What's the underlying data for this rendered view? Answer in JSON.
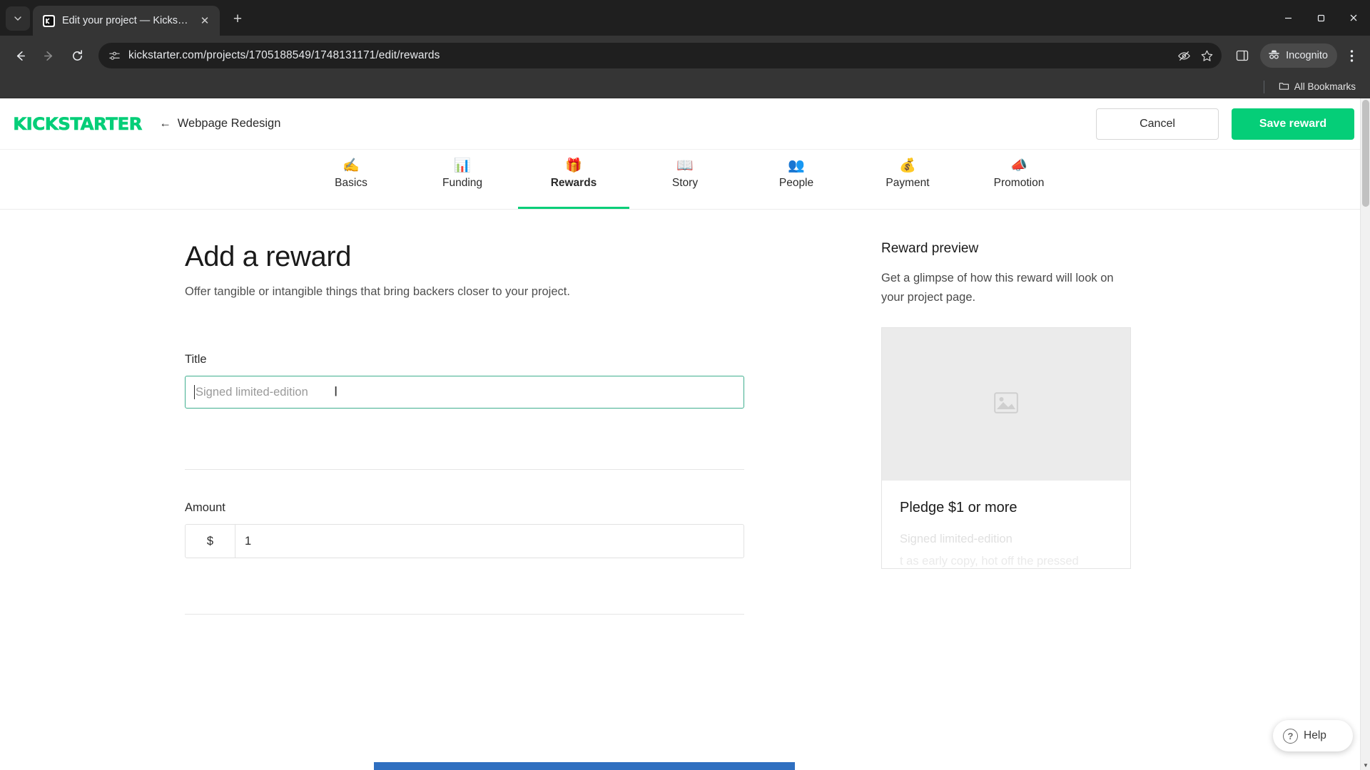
{
  "browser": {
    "tab": {
      "title": "Edit your project — Kickstarter",
      "favicon_name": "kickstarter-favicon",
      "close_label": "✕"
    },
    "new_tab_label": "+",
    "tab_list_label": "⌄",
    "url": "kickstarter.com/projects/1705188549/1748131171/edit/rewards",
    "profile_label": "Incognito",
    "bookmarks": {
      "all_bookmarks_label": "All Bookmarks"
    },
    "window": {
      "minimize": "—",
      "maximize": "▢",
      "close": "✕"
    },
    "menu_label": "⋮"
  },
  "header": {
    "logo": "KICKSTARTER",
    "back_arrow": "←",
    "project_name": "Webpage Redesign",
    "cancel_label": "Cancel",
    "save_label": "Save reward",
    "accent_color": "#05ce78"
  },
  "tabs": [
    {
      "emoji": "✍️",
      "label": "Basics",
      "active": false
    },
    {
      "emoji": "📊",
      "label": "Funding",
      "active": false
    },
    {
      "emoji": "🎁",
      "label": "Rewards",
      "active": true
    },
    {
      "emoji": "📖",
      "label": "Story",
      "active": false
    },
    {
      "emoji": "👥",
      "label": "People",
      "active": false
    },
    {
      "emoji": "💰",
      "label": "Payment",
      "active": false
    },
    {
      "emoji": "📣",
      "label": "Promotion",
      "active": false
    }
  ],
  "main": {
    "title": "Add a reward",
    "subtitle": "Offer tangible or intangible things that bring backers closer to your project.",
    "title_field": {
      "label": "Title",
      "value": "",
      "placeholder": "Signed limited-edition"
    },
    "amount_field": {
      "label": "Amount",
      "currency": "$",
      "value": "1"
    }
  },
  "preview": {
    "title": "Reward preview",
    "description": "Get a glimpse of how this reward will look on your project page.",
    "image_placeholder_icon": "image-placeholder-icon",
    "pledge_title": "Pledge $1 or more",
    "pledge_sub": "Signed limited-edition",
    "pledge_sub2": "t as early copy,   hot off the pressed"
  },
  "help": {
    "label": "Help",
    "icon": "question-mark-icon"
  }
}
